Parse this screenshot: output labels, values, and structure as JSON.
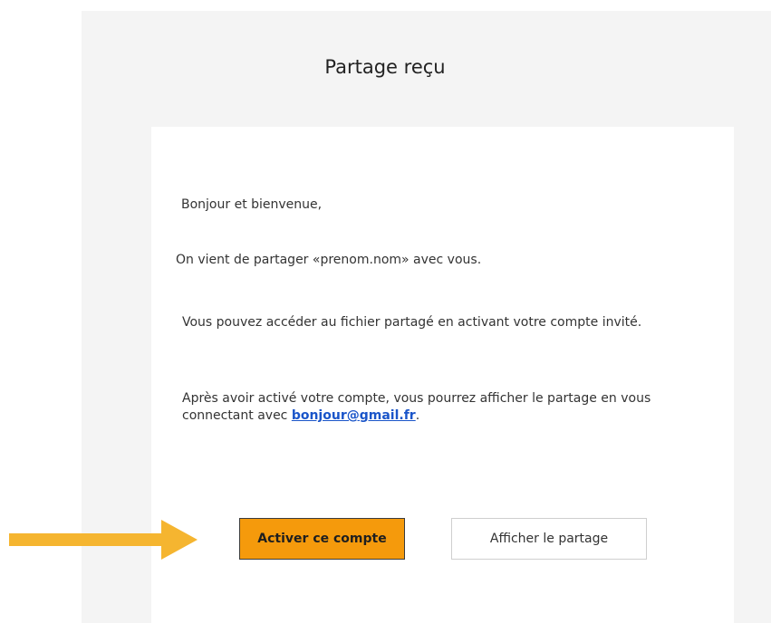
{
  "email": {
    "title": "Partage reçu",
    "greeting": "Bonjour et bienvenue,",
    "shared_before": "On vient de partager «",
    "shared_item": "prenom.nom",
    "shared_after": "» avec vous.",
    "access_text": "Vous pouvez accéder au fichier partagé en activant votre compte invité.",
    "after_text_before": "Après avoir activé votre compte, vous pourrez afficher le partage en vous connectant avec ",
    "email_link": "bonjour@gmail.fr",
    "after_text_after": "."
  },
  "actions": {
    "activate_label": "Activer ce compte",
    "view_label": "Afficher le partage"
  },
  "colors": {
    "primary_button": "#f59a0c",
    "arrow": "#f5b530",
    "link": "#1a55c9",
    "panel_background": "#f4f4f4"
  },
  "icons": {
    "pointer": "arrow-right-icon"
  }
}
